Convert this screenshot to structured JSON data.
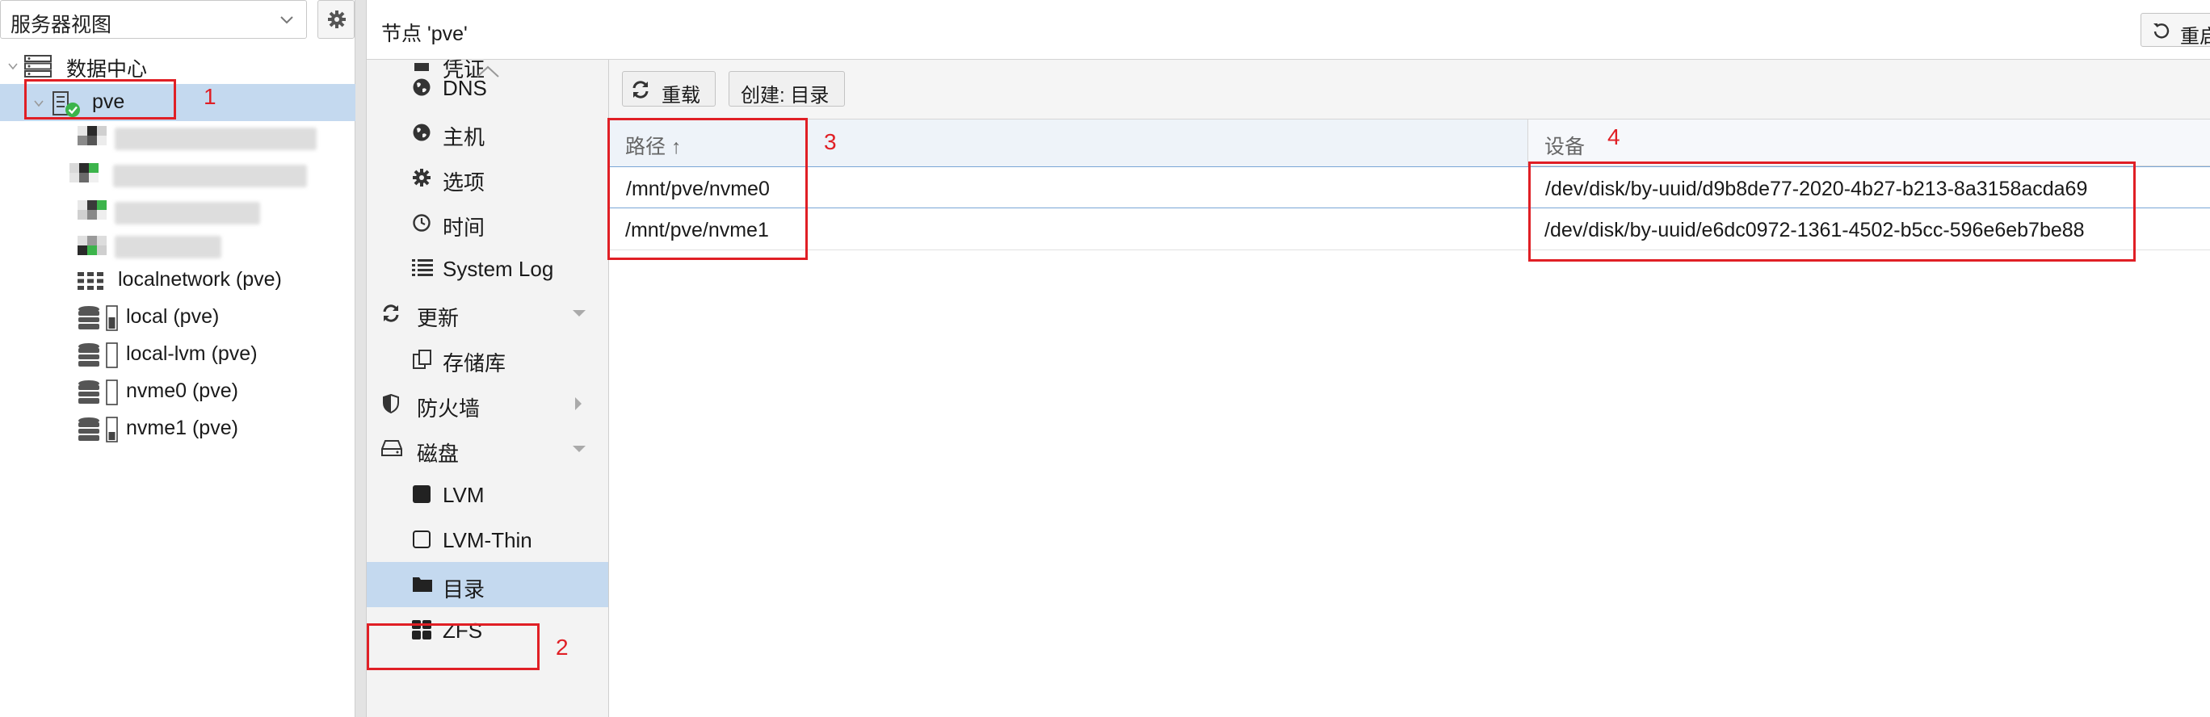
{
  "tree": {
    "view_select": "服务器视图",
    "datacenter": "数据中心",
    "node": "pve",
    "storages": [
      {
        "label": "localnetwork (pve)",
        "icon": "network-grid-icon"
      },
      {
        "label": "local (pve)",
        "icon": "storage-icon"
      },
      {
        "label": "local-lvm (pve)",
        "icon": "storage-icon"
      },
      {
        "label": "nvme0 (pve)",
        "icon": "storage-icon"
      },
      {
        "label": "nvme1 (pve)",
        "icon": "storage-icon"
      }
    ]
  },
  "header": {
    "title": "节点 'pve'",
    "restart_label": "重启"
  },
  "nav": {
    "partial_top": "凭证",
    "items": [
      {
        "label": "DNS",
        "icon": "globe-icon"
      },
      {
        "label": "主机",
        "icon": "globe-icon"
      },
      {
        "label": "选项",
        "icon": "gear-icon"
      },
      {
        "label": "时间",
        "icon": "clock-icon"
      },
      {
        "label": "System Log",
        "icon": "list-icon"
      },
      {
        "label": "更新",
        "icon": "refresh-icon"
      },
      {
        "label": "存储库",
        "icon": "copy-icon"
      },
      {
        "label": "防火墙",
        "icon": "shield-icon"
      },
      {
        "label": "磁盘",
        "icon": "hdd-icon"
      },
      {
        "label": "LVM",
        "icon": "square-filled-icon"
      },
      {
        "label": "LVM-Thin",
        "icon": "square-outline-icon"
      },
      {
        "label": "目录",
        "icon": "folder-icon"
      },
      {
        "label": "ZFS",
        "icon": "grid-icon"
      }
    ]
  },
  "toolbar": {
    "reload_label": "重载",
    "create_label": "创建: 目录"
  },
  "grid": {
    "columns": [
      "路径 ↑",
      "设备"
    ],
    "rows": [
      {
        "path": "/mnt/pve/nvme0",
        "device": "/dev/disk/by-uuid/d9b8de77-2020-4b27-b213-8a3158acda69"
      },
      {
        "path": "/mnt/pve/nvme1",
        "device": "/dev/disk/by-uuid/e6dc0972-1361-4502-b5cc-596e6eb7be88"
      }
    ]
  },
  "annotations": [
    "1",
    "2",
    "3",
    "4"
  ],
  "colors": {
    "selection": "#c4d9ef",
    "annotation_red": "#e01f25",
    "status_ok": "#3cb44b"
  }
}
